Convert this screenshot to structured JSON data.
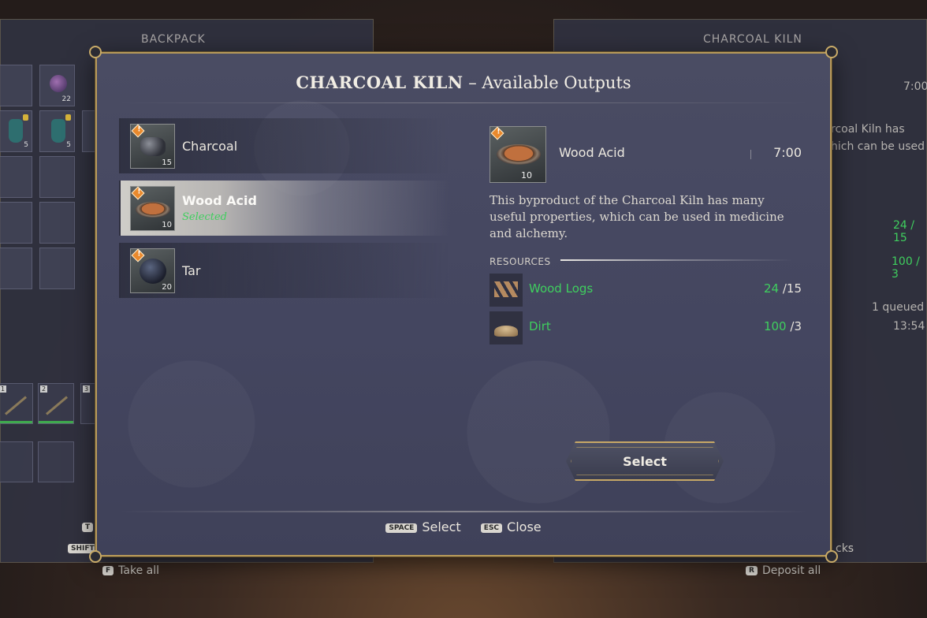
{
  "background": {
    "left_title": "BACKPACK",
    "right_title": "CHARCOAL KILN",
    "slot_counts": [
      "22",
      "5",
      "5"
    ],
    "hotbar_numbers": [
      "1",
      "2",
      "3"
    ],
    "right_time": "7:00",
    "right_desc_line1": "rcoal Kiln has",
    "right_desc_line2": "hich can be used",
    "right_res1": "24 / 15",
    "right_res2": "100 / 3",
    "queued": "1 queued",
    "queued_time": "13:54",
    "cks_text": "cks",
    "hint_take_key": "F",
    "hint_take_label": "Take all",
    "hint_deposit_key": "R",
    "hint_deposit_label": "Deposit all",
    "key_t": "T",
    "key_shift": "SHIFT"
  },
  "modal": {
    "title_strong": "CHARCOAL KILN",
    "title_rest": " – Available Outputs",
    "outputs": [
      {
        "name": "Charcoal",
        "qty": "15",
        "sub": "",
        "icon": "charcoal-icon"
      },
      {
        "name": "Wood Acid",
        "qty": "10",
        "sub": "Selected",
        "icon": "wood-acid-icon"
      },
      {
        "name": "Tar",
        "qty": "20",
        "sub": "",
        "icon": "tar-icon"
      }
    ],
    "detail": {
      "name": "Wood Acid",
      "qty": "10",
      "time": "7:00",
      "description": "This byproduct of the Charcoal Kiln has many useful properties, which can be used in medicine and alchemy.",
      "resources_label": "RESOURCES",
      "resources": [
        {
          "name": "Wood Logs",
          "have": "24",
          "need": "/15"
        },
        {
          "name": "Dirt",
          "have": "100",
          "need": "/3"
        }
      ]
    },
    "select_label": "Select",
    "footer": {
      "select_key": "SPACE",
      "select_label": "Select",
      "close_key": "ESC",
      "close_label": "Close"
    }
  },
  "colors": {
    "accent_gold": "#b89a5a",
    "available_green": "#3fcf5e",
    "warning_orange": "#e9892c"
  }
}
